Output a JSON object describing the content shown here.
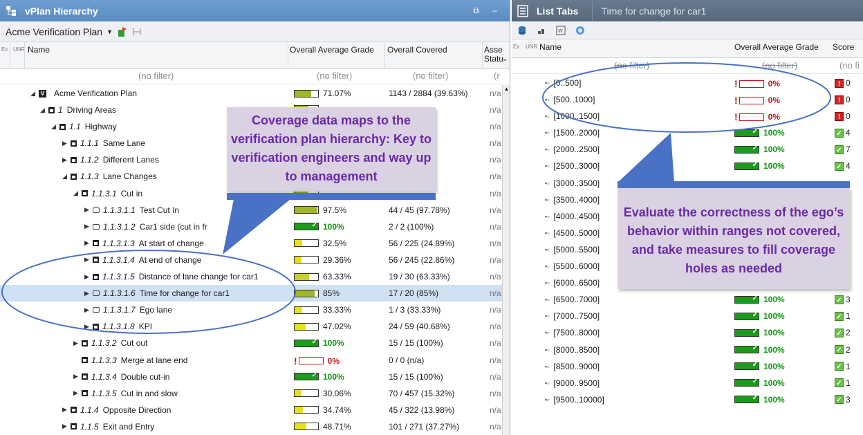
{
  "left_panel": {
    "title": "vPlan Hierarchy",
    "plan_selector": "Acme Verification Plan",
    "columns": {
      "ex": "Ex",
      "unr": "UNR",
      "name": "Name",
      "grade": "Overall Average Grade",
      "covered": "Overall Covered",
      "status_line1": "Asse",
      "status_line2": "Statu"
    },
    "filter": {
      "name": "(no filter)",
      "grade": "(no filter)",
      "covered": "(no filter)",
      "status": "(r"
    },
    "rows": [
      {
        "arrow": "◢",
        "icon": "plan",
        "num": "",
        "label": "Acme Verification Plan",
        "grade": "71.07%",
        "covered": "1143 / 2884 (39.63%)",
        "status": "n/a",
        "indent": 44,
        "fill": 0.71,
        "color": "#9fb82a"
      },
      {
        "arrow": "◢",
        "icon": "section",
        "num": "1",
        "label": "Driving Areas",
        "grade": "",
        "covered": "",
        "status": "n/a",
        "indent": 58,
        "fill": 0.58,
        "color": "#9fb82a"
      },
      {
        "arrow": "◢",
        "icon": "section",
        "num": "1.1",
        "label": "Highway",
        "grade": "",
        "covered": "",
        "status": "n/a",
        "indent": 74,
        "fill": 0.6,
        "color": "#9fb82a"
      },
      {
        "arrow": "▶",
        "icon": "section",
        "num": "1.1.1",
        "label": "Same Lane",
        "grade": "",
        "covered": "",
        "status": "n/a",
        "indent": 90,
        "fill": 0.6,
        "color": "#9fb82a"
      },
      {
        "arrow": "▶",
        "icon": "section",
        "num": "1.1.2",
        "label": "Different Lanes",
        "grade": "",
        "covered": "",
        "status": "n/a",
        "indent": 90,
        "fill": 0.6,
        "color": "#9fb82a"
      },
      {
        "arrow": "◢",
        "icon": "section",
        "num": "1.1.3",
        "label": "Lane Changes",
        "grade": "",
        "covered": "",
        "status": "n/a",
        "indent": 90,
        "fill": 0.6,
        "color": "#9fb82a"
      },
      {
        "arrow": "◢",
        "icon": "section",
        "num": "1.1.3.1",
        "label": "Cut in",
        "grade": "",
        "covered": "",
        "status": "n/a",
        "indent": 106,
        "fill": 0.6,
        "color": "#9fb82a"
      },
      {
        "arrow": "▶",
        "icon": "leaf",
        "num": "1.1.3.1.1",
        "label": "Test Cut In",
        "grade": "97.5%",
        "covered": "44 / 45 (97.78%)",
        "status": "n/a",
        "indent": 122,
        "fill": 0.975,
        "color": "#9fb82a"
      },
      {
        "arrow": "▶",
        "icon": "leaf",
        "num": "1.1.3.1.2",
        "label": "Car1 side (cut in fr",
        "grade": "100%",
        "covered": "2 / 2 (100%)",
        "status": "n/a",
        "indent": 122,
        "fill": 1.0,
        "color": "#1c9a1c",
        "full": true
      },
      {
        "arrow": "▶",
        "icon": "section",
        "num": "1.1.3.1.3",
        "label": "At start of change",
        "grade": "32.5%",
        "covered": "56 / 225 (24.89%)",
        "status": "n/a",
        "indent": 122,
        "fill": 0.325,
        "color": "#e6e21a"
      },
      {
        "arrow": "▶",
        "icon": "section",
        "num": "1.1.3.1.4",
        "label": "At end of change",
        "grade": "29.36%",
        "covered": "56 / 245 (22.86%)",
        "status": "n/a",
        "indent": 122,
        "fill": 0.29,
        "color": "#e6e21a"
      },
      {
        "arrow": "▶",
        "icon": "section",
        "num": "1.1.3.1.5",
        "label": "Distance of lane change for car1",
        "grade": "63.33%",
        "covered": "19 / 30 (63.33%)",
        "status": "n/a",
        "indent": 122,
        "fill": 0.63,
        "color": "#c7cf2a"
      },
      {
        "arrow": "▶",
        "icon": "leaf",
        "num": "1.1.3.1.6",
        "label": "Time for change for car1",
        "grade": "85%",
        "covered": "17 / 20 (85%)",
        "status": "n/a",
        "indent": 122,
        "fill": 0.85,
        "color": "#9fb82a",
        "selected": true
      },
      {
        "arrow": "▶",
        "icon": "leaf",
        "num": "1.1.3.1.7",
        "label": "Ego lane",
        "grade": "33.33%",
        "covered": "1 / 3 (33.33%)",
        "status": "n/a",
        "indent": 122,
        "fill": 0.33,
        "color": "#e6e21a"
      },
      {
        "arrow": "▶",
        "icon": "section",
        "num": "1.1.3.1.8",
        "label": "KPI",
        "grade": "47.02%",
        "covered": "24 / 59 (40.68%)",
        "status": "n/a",
        "indent": 122,
        "fill": 0.47,
        "color": "#e6e21a"
      },
      {
        "arrow": "▶",
        "icon": "section",
        "num": "1.1.3.2",
        "label": "Cut out",
        "grade": "100%",
        "covered": "15 / 15 (100%)",
        "status": "n/a",
        "indent": 106,
        "fill": 1.0,
        "color": "#1c9a1c",
        "full": true
      },
      {
        "arrow": "",
        "icon": "section",
        "num": "1.1.3.3",
        "label": "Merge at lane end",
        "grade": "0%",
        "covered": "0 / 0 (n/a)",
        "status": "n/a",
        "indent": 106,
        "fill": 0,
        "color": "#c01818",
        "zero": true
      },
      {
        "arrow": "▶",
        "icon": "section",
        "num": "1.1.3.4",
        "label": "Double cut-in",
        "grade": "100%",
        "covered": "15 / 15 (100%)",
        "status": "n/a",
        "indent": 106,
        "fill": 1.0,
        "color": "#1c9a1c",
        "full": true
      },
      {
        "arrow": "▶",
        "icon": "section",
        "num": "1.1.3.5",
        "label": "Cut in and slow",
        "grade": "30.06%",
        "covered": "70 / 457 (15.32%)",
        "status": "n/a",
        "indent": 106,
        "fill": 0.3,
        "color": "#e6e21a"
      },
      {
        "arrow": "▶",
        "icon": "section",
        "num": "1.1.4",
        "label": "Opposite Direction",
        "grade": "34.74%",
        "covered": "45 / 322 (13.98%)",
        "status": "n/a",
        "indent": 90,
        "fill": 0.35,
        "color": "#e6e21a"
      },
      {
        "arrow": "▶",
        "icon": "section",
        "num": "1.1.5",
        "label": "Exit and Entry",
        "grade": "48.71%",
        "covered": "101 / 271 (37.27%)",
        "status": "n/a",
        "indent": 90,
        "fill": 0.49,
        "color": "#e6e21a"
      }
    ]
  },
  "right_panel": {
    "title": "List Tabs",
    "subtitle": "Time for change for car1",
    "columns": {
      "ex": "Ex",
      "unr": "UNR",
      "name": "Name",
      "grade": "Overall Average Grade",
      "score": "Score"
    },
    "filter": {
      "name": "(no filter)",
      "grade": "(no filter)",
      "score": "(no fi"
    },
    "rows": [
      {
        "label": "[0..500]",
        "grade": "0%",
        "score": "0",
        "ok": false
      },
      {
        "label": "[500..1000]",
        "grade": "0%",
        "score": "0",
        "ok": false
      },
      {
        "label": "[1000..1500]",
        "grade": "0%",
        "score": "0",
        "ok": false
      },
      {
        "label": "[1500..2000]",
        "grade": "100%",
        "score": "4",
        "ok": true
      },
      {
        "label": "[2000..2500]",
        "grade": "100%",
        "score": "7",
        "ok": true
      },
      {
        "label": "[2500..3000]",
        "grade": "100%",
        "score": "4",
        "ok": true
      },
      {
        "label": "[3000..3500]",
        "grade": "",
        "score": "",
        "ok": true
      },
      {
        "label": "[3500..4000]",
        "grade": "",
        "score": "",
        "ok": true
      },
      {
        "label": "[4000..4500]",
        "grade": "",
        "score": "",
        "ok": true
      },
      {
        "label": "[4500..5000]",
        "grade": "",
        "score": "",
        "ok": true
      },
      {
        "label": "[5000..5500]",
        "grade": "",
        "score": "",
        "ok": true
      },
      {
        "label": "[5500..6000]",
        "grade": "",
        "score": "",
        "ok": true
      },
      {
        "label": "[6000..6500]",
        "grade": "",
        "score": "",
        "ok": true
      },
      {
        "label": "[6500..7000]",
        "grade": "100%",
        "score": "3",
        "ok": true
      },
      {
        "label": "[7000..7500]",
        "grade": "100%",
        "score": "1",
        "ok": true
      },
      {
        "label": "[7500..8000]",
        "grade": "100%",
        "score": "2",
        "ok": true
      },
      {
        "label": "[8000..8500]",
        "grade": "100%",
        "score": "2",
        "ok": true
      },
      {
        "label": "[8500..9000]",
        "grade": "100%",
        "score": "1",
        "ok": true
      },
      {
        "label": "[9000..9500]",
        "grade": "100%",
        "score": "1",
        "ok": true
      },
      {
        "label": "[9500..10000]",
        "grade": "100%",
        "score": "3",
        "ok": true
      }
    ]
  },
  "callouts": {
    "left_text": "Coverage data maps to the verification plan hierarchy: Key to verification engineers and way up to management",
    "right_text": "Evaluate the correctness of the ego’s behavior within ranges not covered, and take measures to fill coverage holes as needed"
  },
  "colors": {
    "accent_blue": "#4a72c4",
    "callout_text": "#6a2aa6",
    "green_bar": "#1c9a1c",
    "red": "#c01818"
  }
}
